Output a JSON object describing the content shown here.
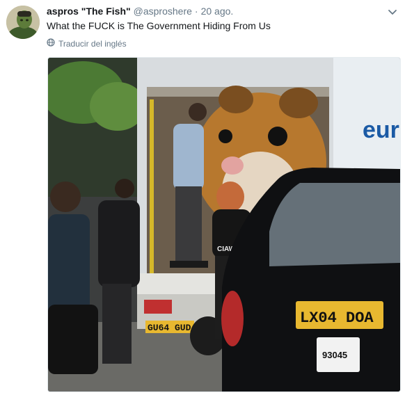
{
  "tweet": {
    "display_name": "aspros \"The Fish\"",
    "handle": "@asproshere",
    "separator": "·",
    "timestamp": "20 ago.",
    "text": "What the FUCK is The Government Hiding From Us",
    "translate_label": "Traducir del inglés"
  },
  "photo": {
    "truck_brand_text": "eure",
    "truck_plate": "GU64 GUD",
    "taxi_plate": "LX04 DOA",
    "taxi_permit_number": "93045",
    "shirt_text": "CIAW"
  },
  "colors": {
    "text_primary": "#14171a",
    "text_secondary": "#657786",
    "plate_yellow": "#e8b830"
  },
  "icons": {
    "menu": "chevron-down-icon",
    "translate": "globe-icon"
  }
}
